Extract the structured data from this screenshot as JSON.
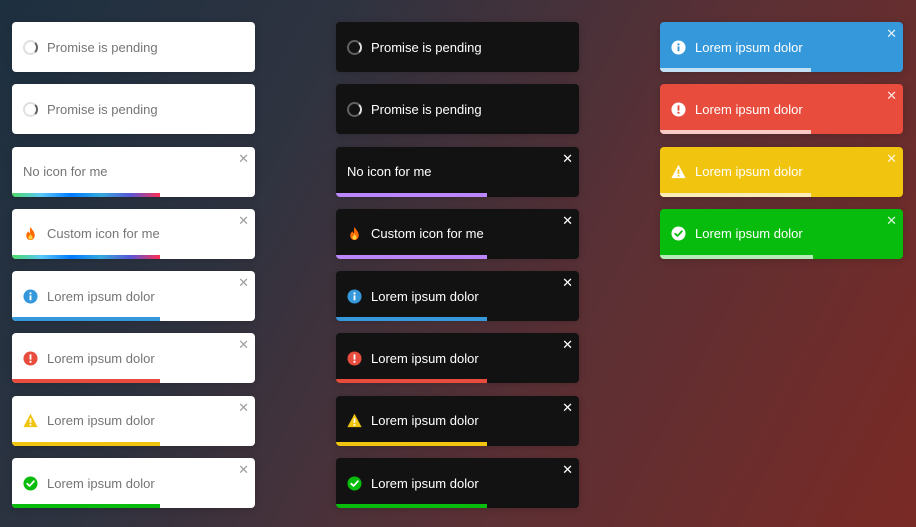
{
  "close_glyph": "✕",
  "colors": {
    "info": "#3498db",
    "error": "#e74c3c",
    "warning": "#f1c40f",
    "success": "#07bc0c",
    "dark_bg": "#121212",
    "violet": "#bb86fc"
  },
  "columns": [
    {
      "theme": "light",
      "toasts": [
        {
          "type": "pending",
          "message": "Promise is pending",
          "icon": "spinner-icon",
          "closable": false,
          "progress": null
        },
        {
          "type": "pending",
          "message": "Promise is pending",
          "icon": "spinner-icon",
          "closable": false,
          "progress": null
        },
        {
          "type": "default",
          "message": "No icon for me",
          "icon": null,
          "closable": true,
          "progress": 0.61
        },
        {
          "type": "default",
          "message": "Custom icon for me",
          "icon": "fire-icon",
          "closable": true,
          "progress": 0.61
        },
        {
          "type": "info",
          "message": "Lorem ipsum dolor",
          "icon": "info-icon",
          "closable": true,
          "progress": 0.61
        },
        {
          "type": "error",
          "message": "Lorem ipsum dolor",
          "icon": "error-icon",
          "closable": true,
          "progress": 0.61
        },
        {
          "type": "warning",
          "message": "Lorem ipsum dolor",
          "icon": "warning-icon",
          "closable": true,
          "progress": 0.61
        },
        {
          "type": "success",
          "message": "Lorem ipsum dolor",
          "icon": "success-icon",
          "closable": true,
          "progress": 0.61
        }
      ]
    },
    {
      "theme": "dark",
      "toasts": [
        {
          "type": "pending",
          "message": "Promise is pending",
          "icon": "spinner-icon",
          "closable": false,
          "progress": null
        },
        {
          "type": "pending",
          "message": "Promise is pending",
          "icon": "spinner-icon",
          "closable": false,
          "progress": null
        },
        {
          "type": "default",
          "message": "No icon for me",
          "icon": null,
          "closable": true,
          "progress": 0.62
        },
        {
          "type": "default",
          "message": "Custom icon for me",
          "icon": "fire-icon",
          "closable": true,
          "progress": 0.62
        },
        {
          "type": "info",
          "message": "Lorem ipsum dolor",
          "icon": "info-icon",
          "closable": true,
          "progress": 0.62
        },
        {
          "type": "error",
          "message": "Lorem ipsum dolor",
          "icon": "error-icon",
          "closable": true,
          "progress": 0.62
        },
        {
          "type": "warning",
          "message": "Lorem ipsum dolor",
          "icon": "warning-icon",
          "closable": true,
          "progress": 0.62
        },
        {
          "type": "success",
          "message": "Lorem ipsum dolor",
          "icon": "success-icon",
          "closable": true,
          "progress": 0.62
        }
      ]
    },
    {
      "theme": "colored",
      "toasts": [
        {
          "type": "info",
          "message": "Lorem ipsum dolor",
          "icon": "info-icon",
          "closable": true,
          "progress": 0.62
        },
        {
          "type": "error",
          "message": "Lorem ipsum dolor",
          "icon": "error-icon",
          "closable": true,
          "progress": 0.62
        },
        {
          "type": "warning",
          "message": "Lorem ipsum dolor",
          "icon": "warning-icon",
          "closable": true,
          "progress": 0.62
        },
        {
          "type": "success",
          "message": "Lorem ipsum dolor",
          "icon": "success-icon",
          "closable": true,
          "progress": 0.63
        }
      ]
    }
  ]
}
